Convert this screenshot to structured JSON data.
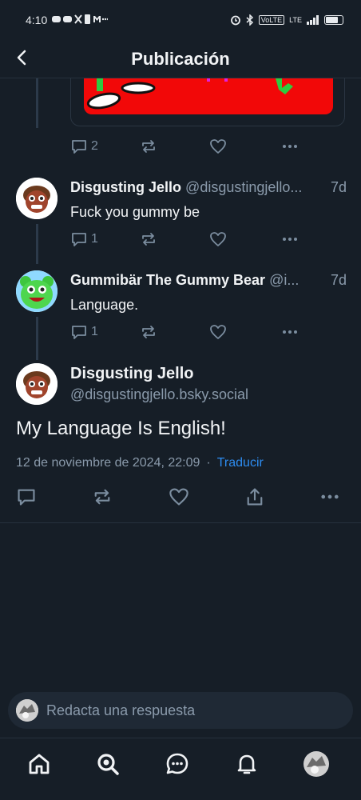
{
  "status_bar": {
    "time": "4:10",
    "notif_icons": [
      "discord-icon",
      "discord-icon",
      "x-icon",
      "sim-icon",
      "gmail-icon",
      "more-icon"
    ],
    "volte": "VoLTE",
    "lte": "LTE"
  },
  "header": {
    "title": "Publicación"
  },
  "posts": [
    {
      "counts": {
        "replies": "2"
      }
    },
    {
      "name": "Disgusting Jello",
      "handle": "@disgustingjello...",
      "time": "7d",
      "text": "Fuck you gummy be",
      "counts": {
        "replies": "1"
      }
    },
    {
      "name": "Gummibär The Gummy Bear",
      "handle": "@i...",
      "time": "7d",
      "text": "Language.",
      "counts": {
        "replies": "1"
      }
    }
  ],
  "main_post": {
    "name": "Disgusting Jello",
    "handle": "@disgustingjello.bsky.social",
    "text": "My Language Is English!",
    "date": "12 de noviembre de 2024, 22:09",
    "separator": "·",
    "translate": "Traducir"
  },
  "reply_bar": {
    "placeholder": "Redacta una respuesta"
  },
  "tab_bar": {
    "items": [
      "home-icon",
      "search-icon",
      "chat-icon",
      "bell-icon",
      "profile-avatar"
    ]
  },
  "colors": {
    "background": "#161e27",
    "muted": "#8a9aab",
    "link": "#2d8cf0",
    "embed_red": "#f20808"
  }
}
